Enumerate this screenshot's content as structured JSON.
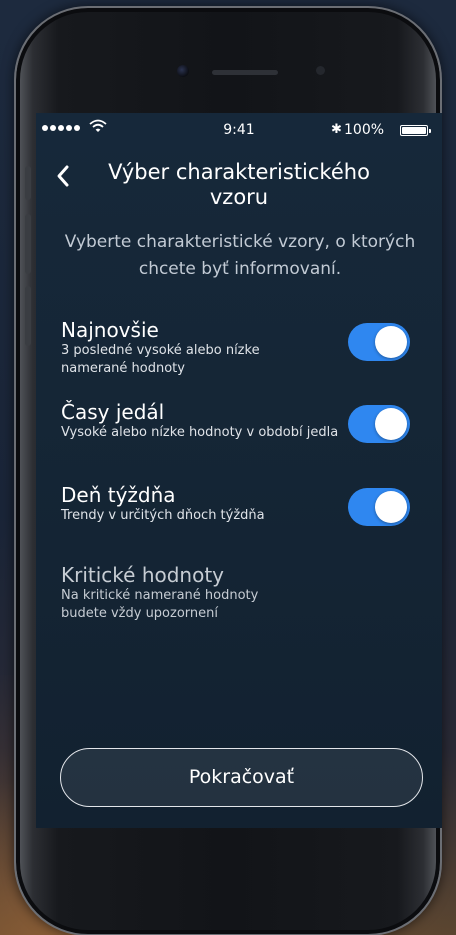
{
  "status_bar": {
    "time": "9:41",
    "bluetooth_glyph": "✱",
    "battery_percent": "100%",
    "battery_level": 1.0
  },
  "nav": {
    "title": "Výber charakteristického vzoru",
    "back_icon": "chevron-left-icon"
  },
  "intro_text": "Vyberte charakteristické vzory, o ktorých chcete byť informovaní.",
  "patterns": [
    {
      "title": "Najnovšie",
      "description": "3 posledné vysoké alebo nízke namerané hodnoty",
      "enabled": true
    },
    {
      "title": "Časy jedál",
      "description": "Vysoké alebo nízke hodnoty v období jedla",
      "enabled": true
    },
    {
      "title": "Deň týždňa",
      "description": "Trendy v určitých dňoch týždňa",
      "enabled": true
    }
  ],
  "critical": {
    "title": "Kritické hodnoty",
    "description": "Na kritické namerané hodnoty budete vždy upozornení"
  },
  "continue_button": {
    "label": "Pokračovať"
  },
  "colors": {
    "accent": "#2f87f0",
    "screen_background": "#16283a",
    "text_primary": "#ffffff",
    "text_secondary": "#c2cad4"
  }
}
